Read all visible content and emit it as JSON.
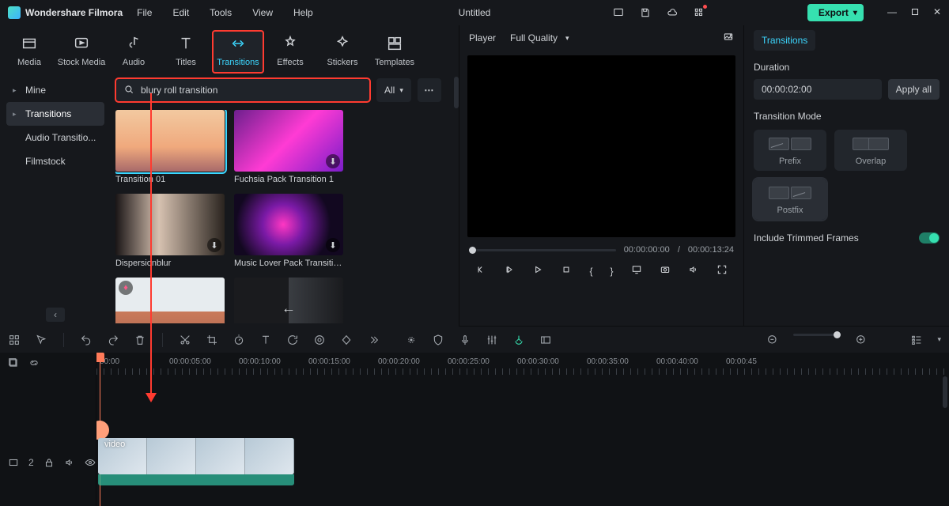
{
  "app": {
    "brand": "Wondershare Filmora",
    "doc_title": "Untitled"
  },
  "menu": {
    "file": "File",
    "edit": "Edit",
    "tools": "Tools",
    "view": "View",
    "help": "Help"
  },
  "export": {
    "label": "Export"
  },
  "nav": {
    "media": "Media",
    "stock": "Stock Media",
    "audio": "Audio",
    "titles": "Titles",
    "transitions": "Transitions",
    "effects": "Effects",
    "stickers": "Stickers",
    "templates": "Templates"
  },
  "cats": {
    "mine": "Mine",
    "transitions": "Transitions",
    "audio": "Audio Transitio...",
    "filmstock": "Filmstock"
  },
  "search": {
    "value": "blury roll transition",
    "all": "All"
  },
  "thumbs": [
    {
      "label": "Transition 01",
      "selected": true,
      "dl": false,
      "fav": false
    },
    {
      "label": "Fuchsia Pack Transition 1",
      "selected": false,
      "dl": true,
      "fav": false
    },
    {
      "label": "Dispersionblur",
      "selected": false,
      "dl": true,
      "fav": false
    },
    {
      "label": "Music Lover Pack Transition ...",
      "selected": false,
      "dl": true,
      "fav": false
    },
    {
      "label": "",
      "selected": false,
      "dl": false,
      "fav": true
    },
    {
      "label": "",
      "selected": false,
      "dl": false,
      "fav": false
    }
  ],
  "player": {
    "label": "Player",
    "quality": "Full Quality",
    "cur": "00:00:00:00",
    "sep": "/",
    "dur": "00:00:13:24"
  },
  "props": {
    "tab": "Transitions",
    "duration_label": "Duration",
    "duration": "00:00:02:00",
    "apply_all": "Apply all",
    "mode_label": "Transition Mode",
    "modes": {
      "prefix": "Prefix",
      "overlap": "Overlap",
      "postfix": "Postfix"
    },
    "include_trim": "Include Trimmed Frames"
  },
  "ruler": [
    "00:00",
    "00:00:05:00",
    "00:00:10:00",
    "00:00:15:00",
    "00:00:20:00",
    "00:00:25:00",
    "00:00:30:00",
    "00:00:35:00",
    "00:00:40:00",
    "00:00:45"
  ],
  "clip": {
    "label": "video"
  },
  "track": {
    "num": "2"
  }
}
